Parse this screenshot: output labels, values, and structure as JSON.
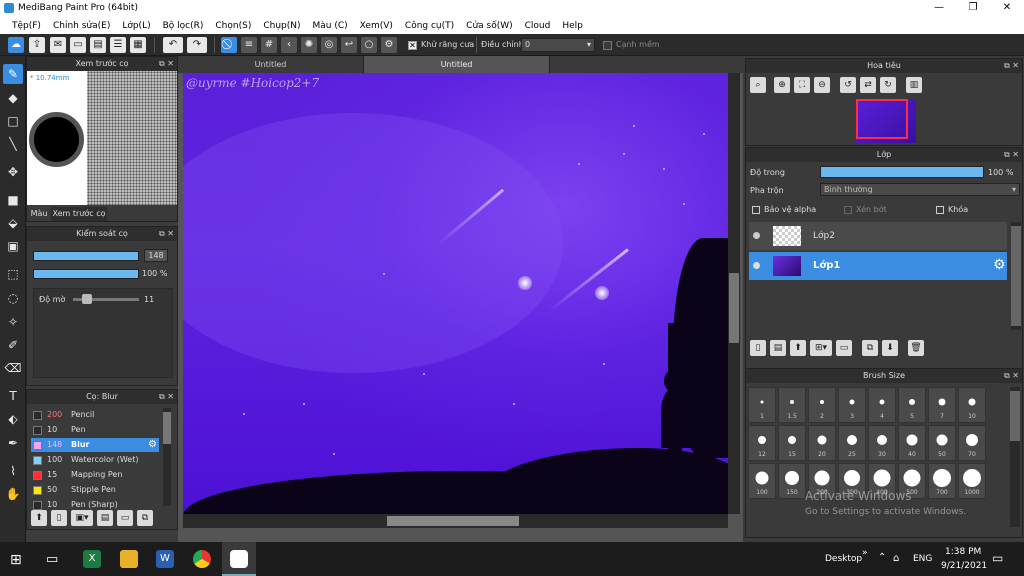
{
  "window": {
    "title": "MediBang Paint Pro (64bit)",
    "minimize": "—",
    "maximize": "❐",
    "close": "✕"
  },
  "menu": [
    "Tệp(F)",
    "Chỉnh sửa(E)",
    "Lớp(L)",
    "Bộ lọc(R)",
    "Chọn(S)",
    "Chụp(N)",
    "Màu (C)",
    "Xem(V)",
    "Công cụ(T)",
    "Cửa số(W)",
    "Cloud",
    "Help"
  ],
  "toolbar": {
    "antialias_label": "Khử răng cưa",
    "correction_label": "Điều chỉnh",
    "correction_value": "0",
    "snap_label": "Cạnh mềm"
  },
  "tabs": [
    "Untitled",
    "Untitled"
  ],
  "canvas": {
    "watermark": "@uyrme #Hoicop2+7"
  },
  "brush_preview": {
    "title": "Xem trước cọ",
    "size": "* 10.74mm",
    "tab_color": "Màu",
    "tab_preview": "Xem trước cọ"
  },
  "brush_control": {
    "title": "Kiểm soát cọ",
    "size_value": "148",
    "opacity_value": "100 %",
    "blur_label": "Độ mờ",
    "blur_value": "11"
  },
  "brush_list": {
    "title": "Cọ: Blur",
    "items": [
      {
        "size": "200",
        "name": "Pencil",
        "color": "#2a2a2a",
        "size_color": "#ff7070"
      },
      {
        "size": "10",
        "name": "Pen",
        "color": "#2a2a2a",
        "size_color": "#dddddd"
      },
      {
        "size": "148",
        "name": "Blur",
        "color": "#ff9ff0",
        "size_color": "#ff9ff0",
        "selected": true
      },
      {
        "size": "100",
        "name": "Watercolor (Wet)",
        "color": "#7fd4ff",
        "size_color": "#dddddd"
      },
      {
        "size": "15",
        "name": "Mapping Pen",
        "color": "#ff3030",
        "size_color": "#dddddd"
      },
      {
        "size": "50",
        "name": "Stipple Pen",
        "color": "#ffe600",
        "size_color": "#dddddd"
      },
      {
        "size": "10",
        "name": "Pen (Sharp)",
        "color": "#2a2a2a",
        "size_color": "#dddddd"
      }
    ]
  },
  "navigator": {
    "title": "Hoa tiêu"
  },
  "layer_panel": {
    "title": "Lớp",
    "opacity_label": "Độ trong",
    "opacity_value": "100 %",
    "opacity": 1.0,
    "blend_label": "Pha trộn",
    "blend_value": "Bình thường",
    "protect_alpha": "Bảo vệ alpha",
    "clipping": "Xén bớt",
    "lock": "Khóa",
    "layers": [
      {
        "name": "Lớp2",
        "selected": false
      },
      {
        "name": "Lớp1",
        "selected": true
      }
    ]
  },
  "brush_size": {
    "title": "Brush Size",
    "sizes": [
      "1",
      "1.5",
      "2",
      "3",
      "4",
      "5",
      "7",
      "10",
      "12",
      "15",
      "20",
      "25",
      "30",
      "40",
      "50",
      "70",
      "100",
      "150",
      "200",
      "300",
      "400",
      "500",
      "700",
      "1000"
    ]
  },
  "watermark_overlay": {
    "line1": "Activate Windows",
    "line2": "Go to Settings to activate Windows."
  },
  "taskbar": {
    "desktop": "Desktop",
    "lang": "ENG",
    "time": "1:38 PM",
    "date": "9/21/2021"
  }
}
